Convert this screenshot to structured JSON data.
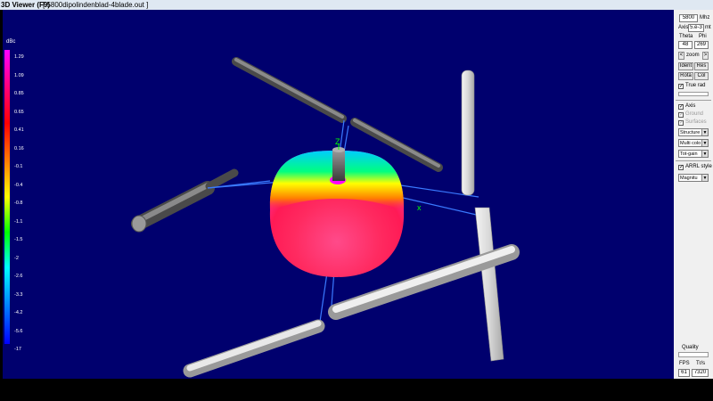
{
  "window": {
    "title": "3D Viewer (F9)",
    "document": "[ 5800dipolindenblad-4blade.out ]"
  },
  "legend": {
    "unit": "dBc",
    "ticks": [
      "1.29",
      "1.09",
      "0.85",
      "0.65",
      "0.41",
      "0.16",
      "-0.1",
      "-0.4",
      "-0.8",
      "-1.1",
      "-1.5",
      "-2",
      "-2.6",
      "-3.3",
      "-4.2",
      "-5.6",
      "-17"
    ],
    "gradient_colors": [
      "#ff00ff",
      "#ff0080",
      "#ff0000",
      "#ff8000",
      "#ffff00",
      "#00ff00",
      "#00ffff",
      "#0080ff",
      "#0000ff"
    ]
  },
  "axes": {
    "z_label": "Z",
    "x_label": "x",
    "color": "#00ff00"
  },
  "panel": {
    "frequency": "5800",
    "frequency_unit": "Mhz",
    "axis_label": "Axis",
    "axis_value": "5.e-3",
    "axis_unit": "mt",
    "theta_label": "Theta",
    "phi_label": "Phi",
    "theta": "48",
    "phi": "269",
    "zoom_label": "zoom",
    "zoom_left": "<",
    "zoom_right": ">",
    "ident_label": "Ident",
    "res_label": "Res",
    "rota_label": "Rota",
    "col_label": "Col",
    "true_rad_label": "True rad",
    "true_rad_checked": "✓",
    "axis_check_label": "Axis",
    "axis_checked": "✓",
    "ground_label": "Ground",
    "ground_checked": "✓",
    "surfaces_label": "Surfaces",
    "surfaces_checked": "✓",
    "structure_select": "Structure",
    "multicolor_select": "Multi colo",
    "totgain_select": "Tot-gain",
    "arrl_label": "ARRL style",
    "arrl_checked": "✓",
    "magnitude_select": "Magnitu",
    "quality_label": "Quality",
    "fps_label": "FPS",
    "tris_label": "Tr/s",
    "fps_value": "61",
    "tris_value": "7320"
  }
}
